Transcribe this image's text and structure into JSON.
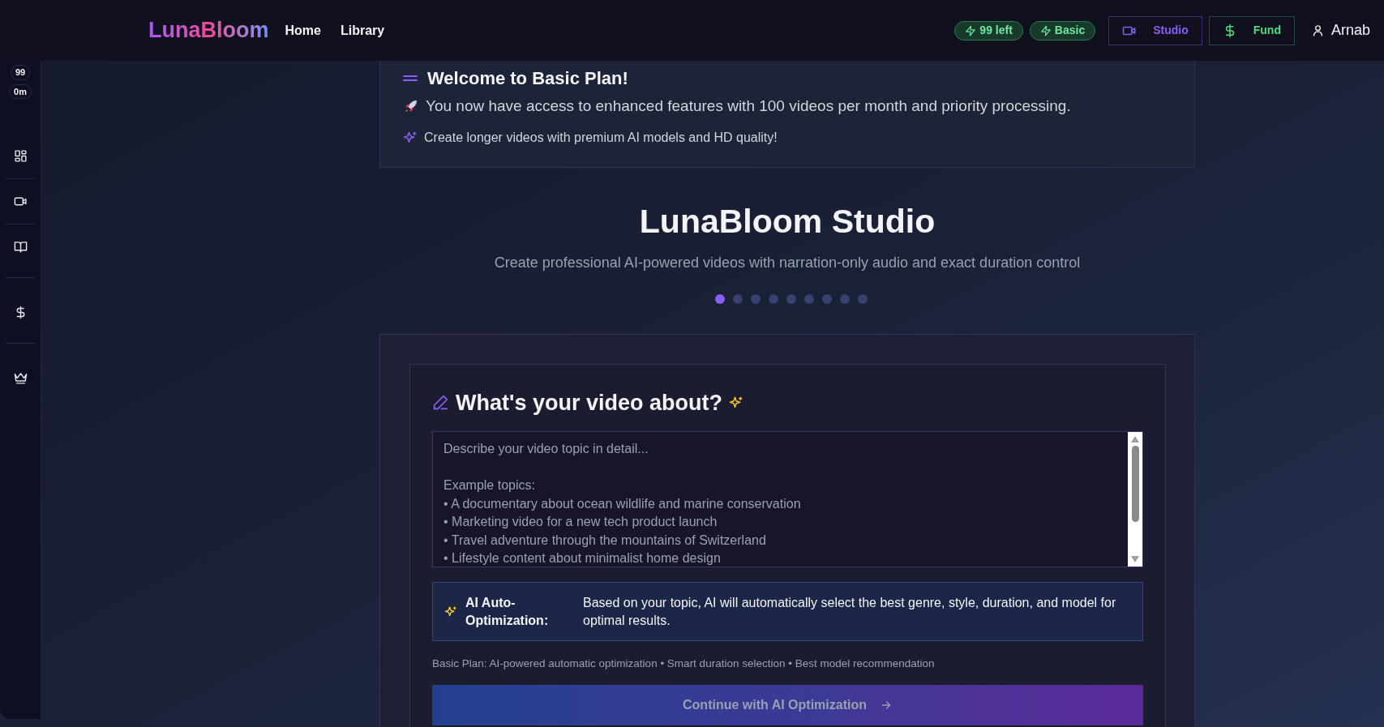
{
  "header": {
    "logo": "LunaBloom",
    "nav": [
      {
        "label": "Home"
      },
      {
        "label": "Library"
      }
    ],
    "badges": [
      {
        "label": "99 left"
      },
      {
        "label": "Basic"
      }
    ],
    "buttons": [
      {
        "kind": "studio",
        "label": "Studio"
      },
      {
        "kind": "fund",
        "label": "Fund"
      }
    ],
    "user": "Arnab"
  },
  "sidebar": {
    "counters": [
      "99",
      "0m"
    ],
    "items": [
      {
        "kind": "grid"
      },
      {
        "kind": "video"
      },
      {
        "kind": "book"
      },
      {
        "kind": "dollar"
      },
      {
        "kind": "crown"
      }
    ]
  },
  "welcome": {
    "title": "Welcome to Basic Plan!",
    "lines": [
      {
        "kind": "rocket",
        "text": "You now have access to enhanced features with 100 videos per month and priority processing."
      },
      {
        "kind": "sparkle",
        "text": "Create longer videos with premium AI models and HD quality!"
      }
    ]
  },
  "studio": {
    "title": "LunaBloom Studio",
    "subtitle": "Create professional AI-powered videos with narration-only audio and exact duration control",
    "steps": [
      {
        "selected": true
      },
      {
        "selected": false
      },
      {
        "selected": false
      },
      {
        "selected": false
      },
      {
        "selected": false
      },
      {
        "selected": false
      },
      {
        "selected": false
      },
      {
        "selected": false
      },
      {
        "selected": false
      }
    ]
  },
  "form": {
    "title": "What's your video about?",
    "topic": {
      "placeholder": "Describe your video topic in detail...\n\nExample topics:\n• A documentary about ocean wildlife and marine conservation\n• Marketing video for a new tech product launch\n• Travel adventure through the mountains of Switzerland\n• Lifestyle content about minimalist home design"
    },
    "optimization": {
      "label": "AI Auto-Optimization:",
      "text": "Based on your topic, AI will automatically select the best genre, style, duration, and model for optimal results."
    },
    "plan_note": "Basic Plan: AI-powered automatic optimization • Smart duration selection • Best model recommendation",
    "continue_button": "Continue with AI Optimization"
  }
}
